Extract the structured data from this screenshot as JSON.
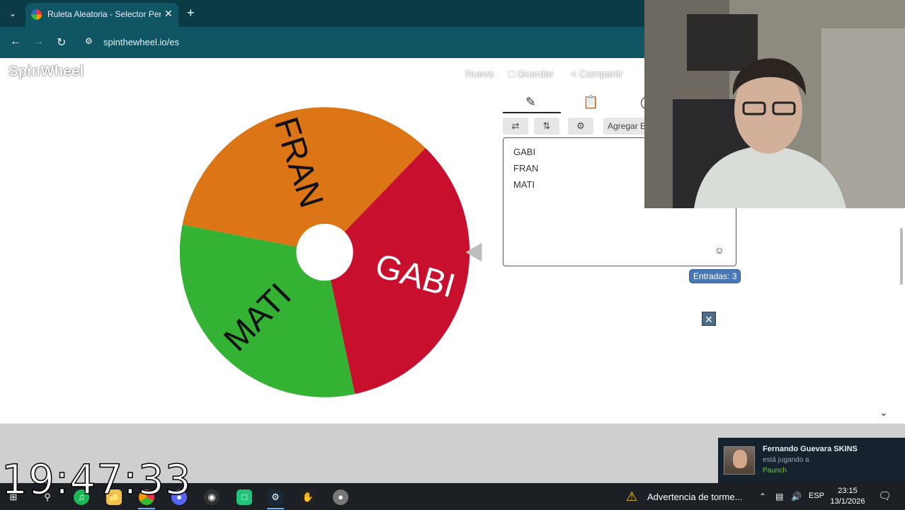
{
  "browser": {
    "tab_title": "Ruleta Aleatoria - Selector Persona",
    "url": "spinthewheel.io/es",
    "tab_menu_icon": "chevron-down-icon",
    "close_icon": "close-icon",
    "new_tab_icon": "plus-icon",
    "back_icon": "arrow-left-icon",
    "forward_icon": "arrow-right-icon",
    "reload_icon": "reload-icon"
  },
  "page": {
    "logo": "SpinWheel",
    "menu": {
      "new": "Nuevo",
      "save": "Guardar",
      "share": "Compartir"
    },
    "editor": {
      "tabs": [
        "edit",
        "results",
        "more"
      ],
      "toolbar": {
        "shuffle_icon": "shuffle-icon",
        "sort_icon": "sort-icon",
        "settings_icon": "gear-icon",
        "add_label": "Agregar E"
      },
      "entries": [
        "GABI",
        "FRAN",
        "MATI"
      ],
      "entries_count": "Entradas: 3"
    }
  },
  "wheel": {
    "segments": [
      {
        "label": "GABI",
        "color": "#c8102e"
      },
      {
        "label": "MATI",
        "color": "#34b233"
      },
      {
        "label": "FRAN",
        "color": "#dc7515"
      }
    ],
    "pointer_color": "#bdbdbd"
  },
  "overlay": {
    "clock": "19:47:33"
  },
  "steam_notification": {
    "name": "Fernando Guevara SKINS",
    "status": "está jugando a",
    "game": "Paunch"
  },
  "taskbar": {
    "warning_text": "Advertencia de torme...",
    "language": "ESP",
    "time": "23:15",
    "date": "13/1/2026"
  },
  "colors": {
    "browser_frame": "#0f5563",
    "badge": "#4a78b5"
  }
}
